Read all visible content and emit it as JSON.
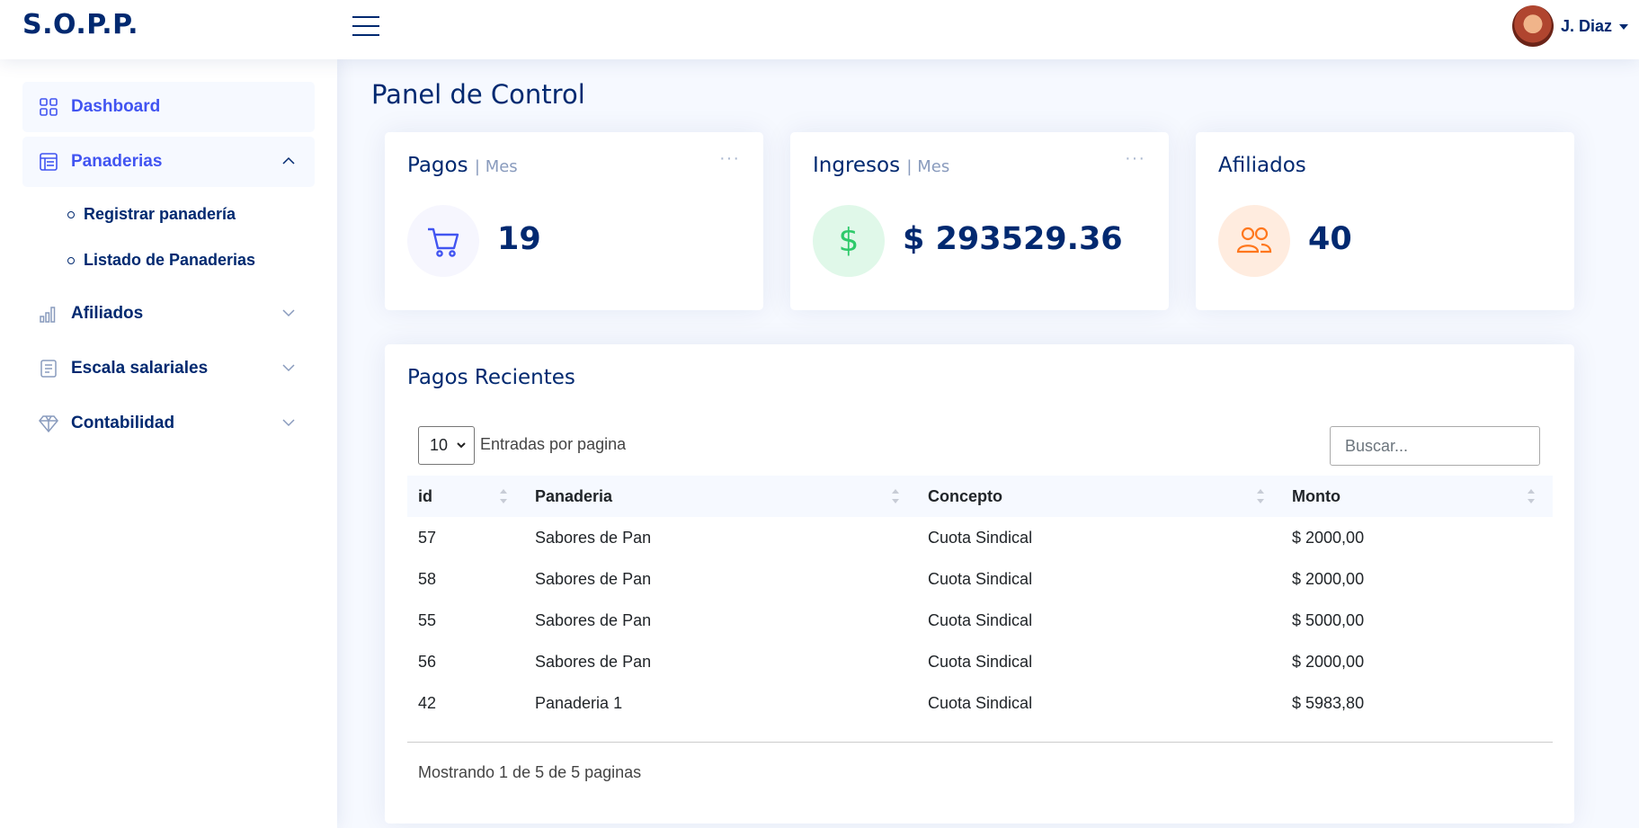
{
  "header": {
    "logo": "S.O.P.P.",
    "user_name": "J. Diaz"
  },
  "sidebar": {
    "items": [
      {
        "label": "Dashboard",
        "icon": "grid-icon"
      },
      {
        "label": "Panaderias",
        "icon": "table-icon",
        "expanded": true,
        "children": [
          {
            "label": "Registrar panadería"
          },
          {
            "label": "Listado de Panaderias"
          }
        ]
      },
      {
        "label": "Afiliados",
        "icon": "bar-chart-icon"
      },
      {
        "label": "Escala salariales",
        "icon": "journal-text-icon"
      },
      {
        "label": "Contabilidad",
        "icon": "gem-icon"
      }
    ]
  },
  "main": {
    "page_title": "Panel de Control",
    "cards": [
      {
        "title": "Pagos",
        "subtitle": "| Mes",
        "value": "19",
        "icon": "cart-icon",
        "icon_color": "#4154f1",
        "bg_color": "#f6f6fe"
      },
      {
        "title": "Ingresos",
        "subtitle": "| Mes",
        "value": "$ 293529.36",
        "icon": "dollar-icon",
        "icon_color": "#2eca6a",
        "bg_color": "#e0f8e9"
      },
      {
        "title": "Afiliados",
        "subtitle": "",
        "value": "40",
        "icon": "people-icon",
        "icon_color": "#ff771d",
        "bg_color": "#ffecdf"
      }
    ],
    "more_symbol": "···",
    "recent": {
      "title": "Pagos Recientes",
      "per_page_value": "10",
      "per_page_label": "Entradas por pagina",
      "search_placeholder": "Buscar...",
      "columns": [
        "id",
        "Panaderia",
        "Concepto",
        "Monto"
      ],
      "rows": [
        [
          "57",
          "Sabores de Pan",
          "Cuota Sindical",
          "$ 2000,00"
        ],
        [
          "58",
          "Sabores de Pan",
          "Cuota Sindical",
          "$ 2000,00"
        ],
        [
          "55",
          "Sabores de Pan",
          "Cuota Sindical",
          "$ 5000,00"
        ],
        [
          "56",
          "Sabores de Pan",
          "Cuota Sindical",
          "$ 2000,00"
        ],
        [
          "42",
          "Panaderia 1",
          "Cuota Sindical",
          "$ 5983,80"
        ]
      ],
      "footer": "Mostrando 1 de 5 de 5 paginas"
    }
  }
}
